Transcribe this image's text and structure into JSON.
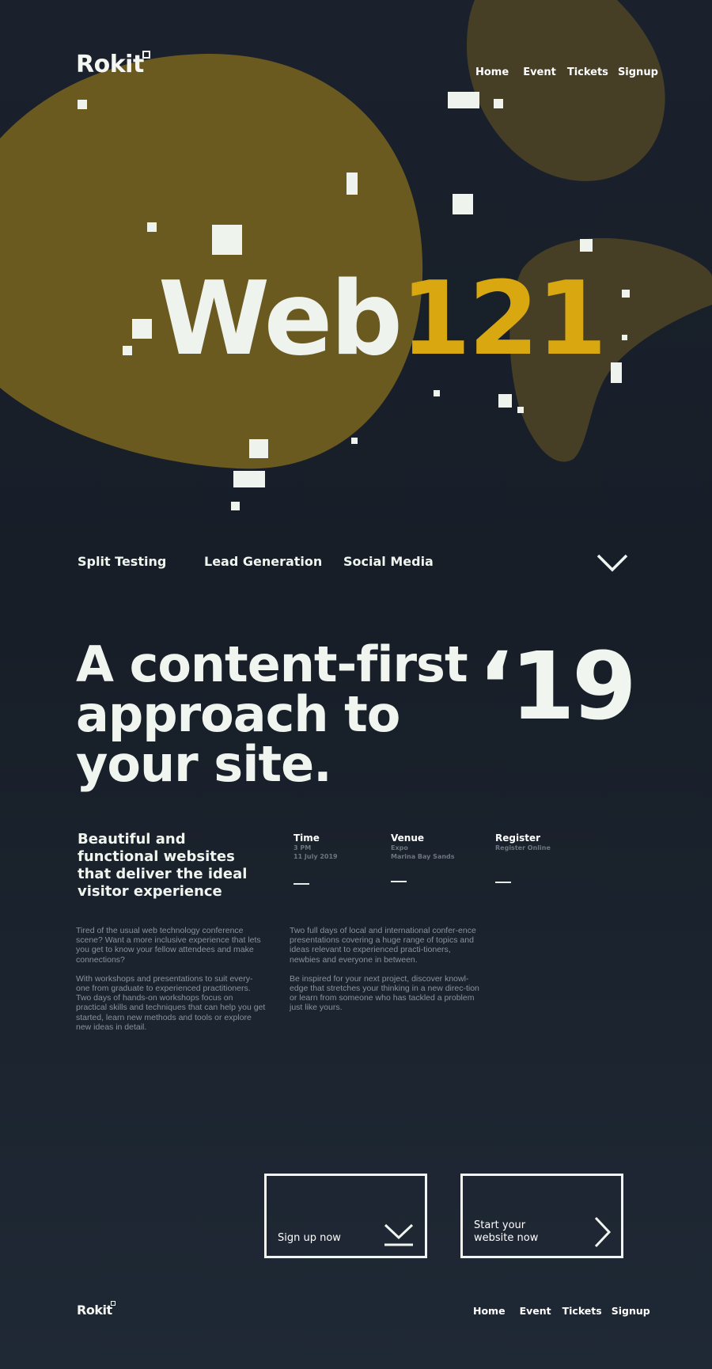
{
  "header": {
    "logo": "Rokit",
    "nav": [
      "Home",
      "Event",
      "Tickets",
      "Signup"
    ]
  },
  "hero": {
    "title_word": "Web",
    "title_number": "121",
    "colors": {
      "accent": "#d9a70f",
      "blob": "#6b5a20",
      "background": "#1a212c",
      "text": "#eef3ee"
    }
  },
  "topics": [
    "Split Testing",
    "Lead Generation",
    "Social Media"
  ],
  "scroll_icon": "chevron-down-icon",
  "intro": {
    "headline": [
      "A content-first",
      "approach to",
      "your site."
    ],
    "year": "‘19",
    "subheading": "Beautiful and functional websites that deliver the ideal visitor experience"
  },
  "details": [
    {
      "title": "Time",
      "lines": [
        "3 PM",
        "11 July 2019"
      ]
    },
    {
      "title": "Venue",
      "lines": [
        "Expo",
        "Marina Bay Sands"
      ]
    },
    {
      "title": "Register",
      "lines": [
        "Register Online"
      ]
    }
  ],
  "paragraphs": {
    "left": [
      "Tired of the usual web technology conference scene? Want a more inclusive experience that lets you get to know your fellow attendees and make connections?",
      "With workshops and presentations to suit every-one from graduate to experienced practitioners. Two days of hands-on workshops focus on practical skills and techniques that can help you get started, learn new methods and tools or explore new ideas in detail."
    ],
    "right": [
      "Two full days of local and international confer-ence presentations covering a huge range of topics and ideas relevant to experienced practi-tioners, newbies and everyone in between.",
      "Be inspired for your next project, discover knowl-edge that stretches your thinking in a new direc-tion or learn from someone who has tackled a problem just like yours."
    ]
  },
  "cta": {
    "signup": {
      "label": "Sign up now",
      "icon": "download-chevron-icon"
    },
    "start": {
      "label_line1": "Start your",
      "label_line2": "website now",
      "icon": "chevron-right-icon"
    }
  },
  "footer": {
    "logo": "Rokit",
    "nav": [
      "Home",
      "Event",
      "Tickets",
      "Signup"
    ]
  }
}
